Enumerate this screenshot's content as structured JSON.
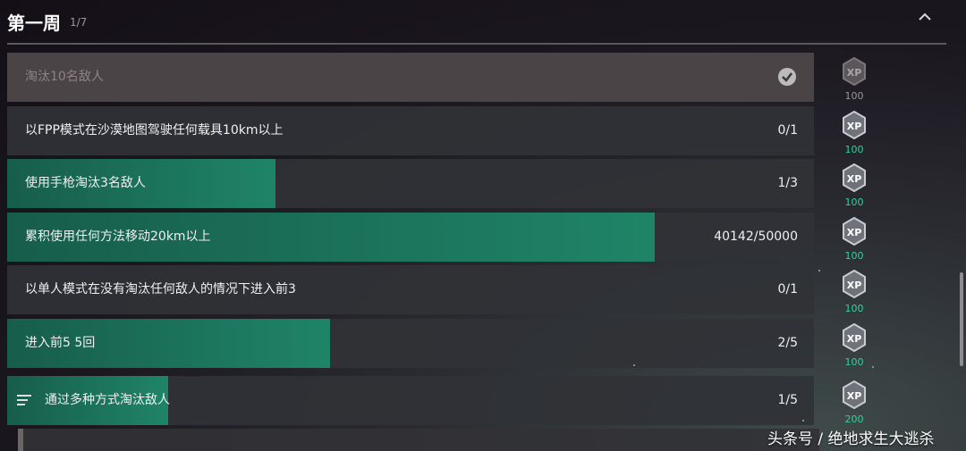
{
  "header": {
    "title": "第一周",
    "progress": "1/7",
    "collapse_icon": "chevron-up-icon"
  },
  "challenges": [
    {
      "label": "淘汰10名敌人",
      "progress": "",
      "status": "completed",
      "fill": 1.0
    },
    {
      "label": "以FPP模式在沙漠地图驾驶任何载具10km以上",
      "progress": "0/1",
      "status": "active",
      "fill": 0.0
    },
    {
      "label": "使用手枪淘汰3名敌人",
      "progress": "1/3",
      "status": "active",
      "fill": 0.333
    },
    {
      "label": "累积使用任何方法移动20km以上",
      "progress": "40142/50000",
      "status": "active",
      "fill": 0.8028
    },
    {
      "label": "以单人模式在没有淘汰任何敌人的情况下进入前3",
      "progress": "0/1",
      "status": "active",
      "fill": 0.0
    },
    {
      "label": "进入前5 5回",
      "progress": "2/5",
      "status": "active",
      "fill": 0.4
    },
    {
      "label": "通过多种方式淘汰敌人",
      "progress": "1/5",
      "status": "group",
      "fill": 0.2,
      "icon": "list-icon"
    }
  ],
  "rewards": [
    {
      "xp": "100",
      "claimed": true
    },
    {
      "xp": "100",
      "claimed": false
    },
    {
      "xp": "100",
      "claimed": false
    },
    {
      "xp": "100",
      "claimed": false
    },
    {
      "xp": "100",
      "claimed": false
    },
    {
      "xp": "100",
      "claimed": false
    },
    {
      "xp": "200",
      "claimed": false
    }
  ],
  "watermark": "头条号 / 绝地求生大逃杀",
  "colors": {
    "progress_fill": "#1f8467",
    "xp_text": "#2fd39b",
    "row_bg": "#303236",
    "completed_row_bg": "#4b4447"
  }
}
